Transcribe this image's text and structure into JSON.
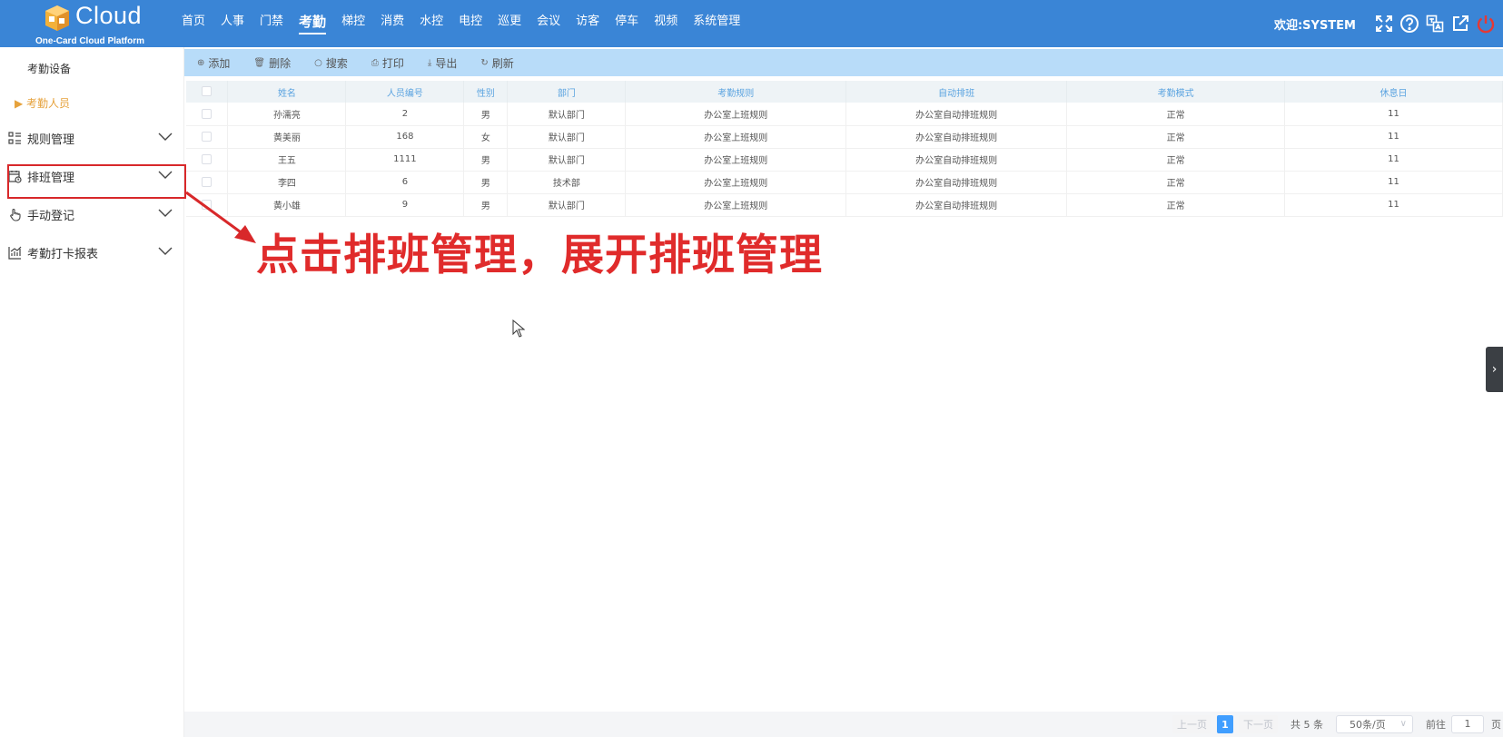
{
  "brand": {
    "name": "Cloud",
    "subtitle": "One-Card Cloud Platform"
  },
  "nav": {
    "items": [
      "首页",
      "人事",
      "门禁",
      "考勤",
      "梯控",
      "消费",
      "水控",
      "电控",
      "巡更",
      "会议",
      "访客",
      "停车",
      "视频",
      "系统管理"
    ],
    "active": "考勤"
  },
  "header": {
    "welcome": "欢迎:SYSTEM",
    "icons": [
      "fullscreen-icon",
      "help-icon",
      "translate-icon",
      "external-link-icon",
      "power-icon"
    ],
    "power_color": "#e53935"
  },
  "sidebar": {
    "sub_items": [
      "考勤设备",
      "考勤人员"
    ],
    "active_sub": "考勤人员",
    "groups": [
      {
        "label": "规则管理",
        "icon": "rules-list-icon"
      },
      {
        "label": "排班管理",
        "icon": "schedule-calendar-icon"
      },
      {
        "label": "手动登记",
        "icon": "hand-pointer-icon"
      },
      {
        "label": "考勤打卡报表",
        "icon": "report-chart-icon"
      }
    ]
  },
  "toolbar": {
    "buttons": [
      {
        "label": "添加",
        "icon": "plus-circle-icon"
      },
      {
        "label": "删除",
        "icon": "trash-icon"
      },
      {
        "label": "搜索",
        "icon": "search-icon"
      },
      {
        "label": "打印",
        "icon": "print-icon"
      },
      {
        "label": "导出",
        "icon": "download-icon"
      },
      {
        "label": "刷新",
        "icon": "refresh-icon"
      }
    ]
  },
  "table": {
    "columns": [
      "姓名",
      "人员编号",
      "性别",
      "部门",
      "考勤规则",
      "自动排班",
      "考勤模式",
      "休息日"
    ],
    "rows": [
      [
        "孙濡亮",
        "2",
        "男",
        "默认部门",
        "办公室上班规则",
        "办公室自动排班规则",
        "正常",
        "11"
      ],
      [
        "黄美丽",
        "168",
        "女",
        "默认部门",
        "办公室上班规则",
        "办公室自动排班规则",
        "正常",
        "11"
      ],
      [
        "王五",
        "1111",
        "男",
        "默认部门",
        "办公室上班规则",
        "办公室自动排班规则",
        "正常",
        "11"
      ],
      [
        "李四",
        "6",
        "男",
        "技术部",
        "办公室上班规则",
        "办公室自动排班规则",
        "正常",
        "11"
      ],
      [
        "黄小雄",
        "9",
        "男",
        "默认部门",
        "办公室上班规则",
        "办公室自动排班规则",
        "正常",
        "11"
      ]
    ]
  },
  "annotation": {
    "text": "点击排班管理，展开排班管理",
    "color": "#e02b2b"
  },
  "pagination": {
    "prev": "上一页",
    "current": "1",
    "next": "下一页",
    "total": "共 5 条",
    "page_size": "50条/页",
    "goto_label": "前往",
    "goto_value": "1",
    "page_suffix": "页"
  },
  "colors": {
    "header_bg": "#3a85d6",
    "toolbar_bg": "#b8dcf9",
    "accent": "#409eff",
    "active_sub": "#e6a23c"
  }
}
